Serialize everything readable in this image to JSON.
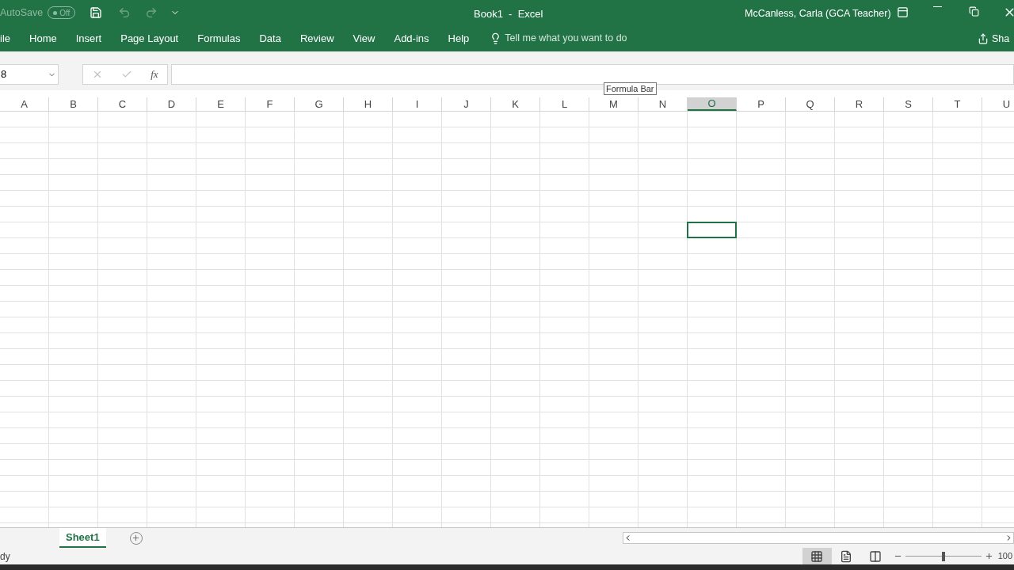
{
  "title_bar": {
    "autosave_label": "AutoSave",
    "autosave_toggle": {
      "label": "Off",
      "on": false
    },
    "undo_disabled": true,
    "redo_disabled": true,
    "title": "Book1  -  Excel",
    "user": "McCanless, Carla (GCA Teacher)"
  },
  "ribbon_tabs": [
    {
      "label": "ile",
      "selected": false
    },
    {
      "label": "Home",
      "selected": false
    },
    {
      "label": "Insert",
      "selected": false
    },
    {
      "label": "Page Layout",
      "selected": false
    },
    {
      "label": "Formulas",
      "selected": false
    },
    {
      "label": "Data",
      "selected": false
    },
    {
      "label": "Review",
      "selected": false
    },
    {
      "label": "View",
      "selected": false
    },
    {
      "label": "Add-ins",
      "selected": false
    },
    {
      "label": "Help",
      "selected": false
    }
  ],
  "tell_me": "Tell me what you want to do",
  "share": "Sha",
  "formula_bar": {
    "name_box": "8",
    "fx": "fx",
    "tooltip": "Formula Bar"
  },
  "columns": [
    {
      "label": "A",
      "selected": false
    },
    {
      "label": "B",
      "selected": false
    },
    {
      "label": "C",
      "selected": false
    },
    {
      "label": "D",
      "selected": false
    },
    {
      "label": "E",
      "selected": false
    },
    {
      "label": "F",
      "selected": false
    },
    {
      "label": "G",
      "selected": false
    },
    {
      "label": "H",
      "selected": false
    },
    {
      "label": "I",
      "selected": false
    },
    {
      "label": "J",
      "selected": false
    },
    {
      "label": "K",
      "selected": false
    },
    {
      "label": "L",
      "selected": false
    },
    {
      "label": "M",
      "selected": false
    },
    {
      "label": "N",
      "selected": false
    },
    {
      "label": "O",
      "selected": true
    },
    {
      "label": "P",
      "selected": false
    },
    {
      "label": "Q",
      "selected": false
    },
    {
      "label": "R",
      "selected": false
    },
    {
      "label": "S",
      "selected": false
    },
    {
      "label": "T",
      "selected": false
    },
    {
      "label": "U",
      "selected": false
    }
  ],
  "rows": [
    {
      "selected": false
    },
    {
      "selected": false
    },
    {
      "selected": false
    },
    {
      "selected": false
    },
    {
      "selected": false
    },
    {
      "selected": false
    },
    {
      "selected": false
    },
    {
      "selected": true
    },
    {
      "selected": false
    },
    {
      "selected": false
    },
    {
      "selected": false
    },
    {
      "selected": false
    },
    {
      "selected": false
    },
    {
      "selected": false
    },
    {
      "selected": false
    },
    {
      "selected": false
    },
    {
      "selected": false
    },
    {
      "selected": false
    },
    {
      "selected": false
    },
    {
      "selected": false
    },
    {
      "selected": false
    },
    {
      "selected": false
    },
    {
      "selected": false
    },
    {
      "selected": false
    },
    {
      "selected": false
    },
    {
      "selected": false
    },
    {
      "selected": false
    }
  ],
  "sheet_tabs": [
    {
      "label": "Sheet1",
      "selected": true
    }
  ],
  "status_bar": {
    "status": "dy",
    "views": [
      {
        "kind": "normal",
        "selected": true
      },
      {
        "kind": "page_layout",
        "selected": false
      },
      {
        "kind": "page_break",
        "selected": false
      }
    ],
    "zoom": {
      "level": 0.5
    },
    "zoom_label": "100"
  }
}
